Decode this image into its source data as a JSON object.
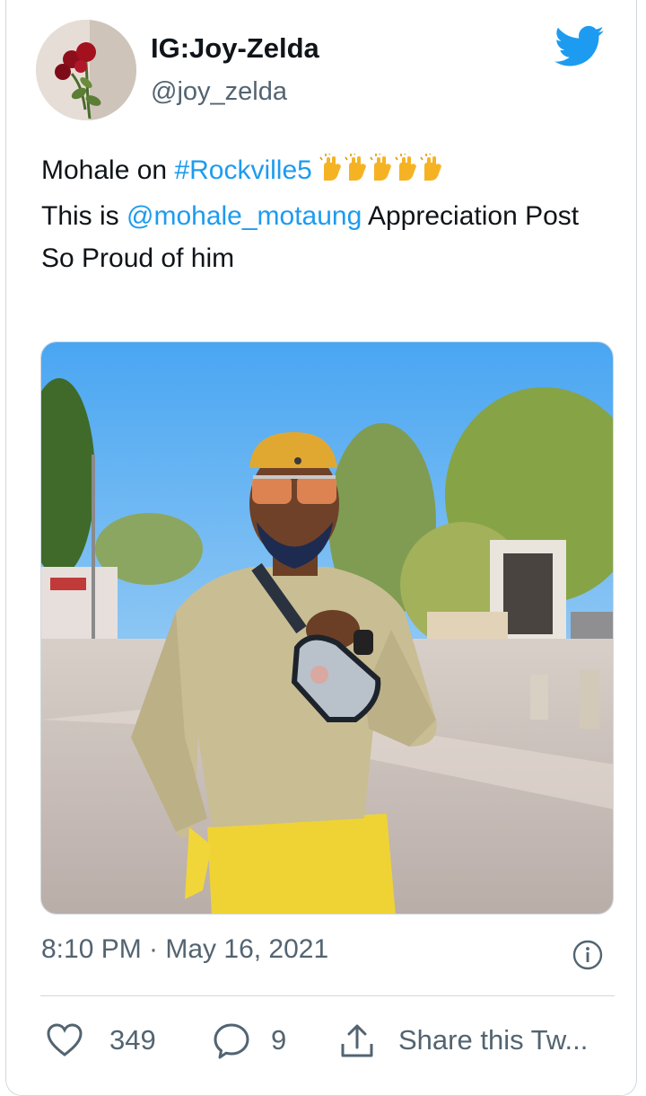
{
  "author": {
    "name": "IG:Joy-Zelda",
    "handle": "@joy_zelda",
    "avatar_icon": "rose-avatar"
  },
  "brand": {
    "icon": "twitter-bird-icon",
    "color": "#1d9bf0"
  },
  "tweet": {
    "line1_prefix": "Mohale on ",
    "hashtag": "#Rockville5",
    "emoji": "raising-hands-emoji",
    "emoji_count": 5,
    "line2_prefix": "This is ",
    "mention": "@mohale_motaung",
    "line2_suffix": " Appreciation Post",
    "line3": "So Proud of him"
  },
  "media": {
    "icon": "photo-man-in-yellow-cap"
  },
  "meta": {
    "timestamp": "8:10 PM · May 16, 2021",
    "info_icon": "info-icon"
  },
  "actions": {
    "like_count": "349",
    "reply_count": "9",
    "share_label": "Share this Tw..."
  },
  "colors": {
    "text": "#0f1419",
    "secondary": "#536471",
    "link": "#1d9bf0",
    "border": "#cfd9de"
  }
}
